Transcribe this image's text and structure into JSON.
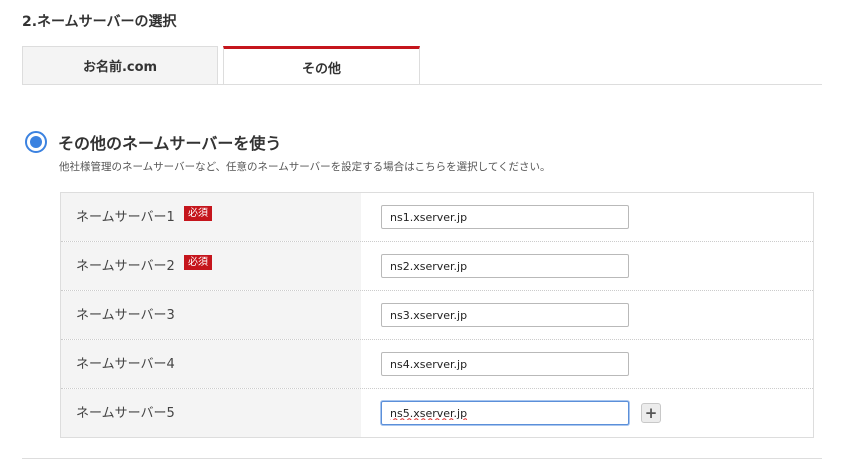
{
  "section": {
    "title": "2.ネームサーバーの選択"
  },
  "tabs": [
    {
      "label": "お名前.com",
      "active": false
    },
    {
      "label": "その他",
      "active": true
    }
  ],
  "option": {
    "label": "その他のネームサーバーを使う",
    "description": "他社様管理のネームサーバーなど、任意のネームサーバーを設定する場合はこちらを選択してください。",
    "selected": true
  },
  "nameservers": [
    {
      "label": "ネームサーバー1",
      "required": "必須",
      "value": "ns1.xserver.jp"
    },
    {
      "label": "ネームサーバー2",
      "required": "必須",
      "value": "ns2.xserver.jp"
    },
    {
      "label": "ネームサーバー3",
      "value": "ns3.xserver.jp"
    },
    {
      "label": "ネームサーバー4",
      "value": "ns4.xserver.jp"
    },
    {
      "label": "ネームサーバー5",
      "value": "ns5.xserver.jp"
    }
  ],
  "add_button": {
    "label": "+"
  },
  "colors": {
    "accent_red": "#c5151c",
    "radio_blue": "#3b82e0"
  }
}
